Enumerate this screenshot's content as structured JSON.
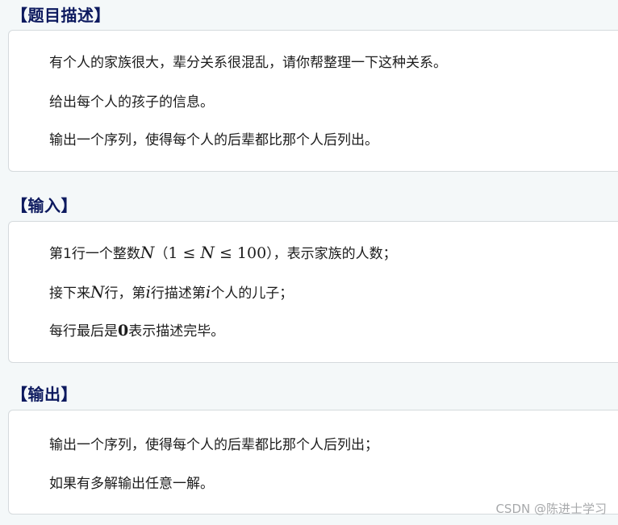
{
  "sections": {
    "description": {
      "title": "【题目描述】",
      "lines": [
        "有个人的家族很大，辈分关系很混乱，请你帮整理一下这种关系。",
        "给出每个人的孩子的信息。",
        "输出一个序列，使得每个人的后辈都比那个人后列出。"
      ]
    },
    "input": {
      "title": "【输入】",
      "line1": {
        "pre": "第1行一个整数",
        "var": "N",
        "range_open": "（",
        "range_a": "1 ≤ ",
        "range_var": "N",
        "range_b": " ≤ 100",
        "range_close": "），表示家族的人数；"
      },
      "line2": {
        "pre": "接下来",
        "var_n": "N",
        "mid1": "行，第",
        "var_i1": "i",
        "mid2": "行描述第",
        "var_i2": "i",
        "post": "个人的儿子；"
      },
      "line3": {
        "pre": "每行最后是",
        "zero": "0",
        "post": "表示描述完毕。"
      }
    },
    "output": {
      "title": "【输出】",
      "lines": [
        "输出一个序列，使得每个人的后辈都比那个人后列出；",
        "如果有多解输出任意一解。"
      ]
    }
  },
  "watermark": "CSDN @陈进士学习"
}
